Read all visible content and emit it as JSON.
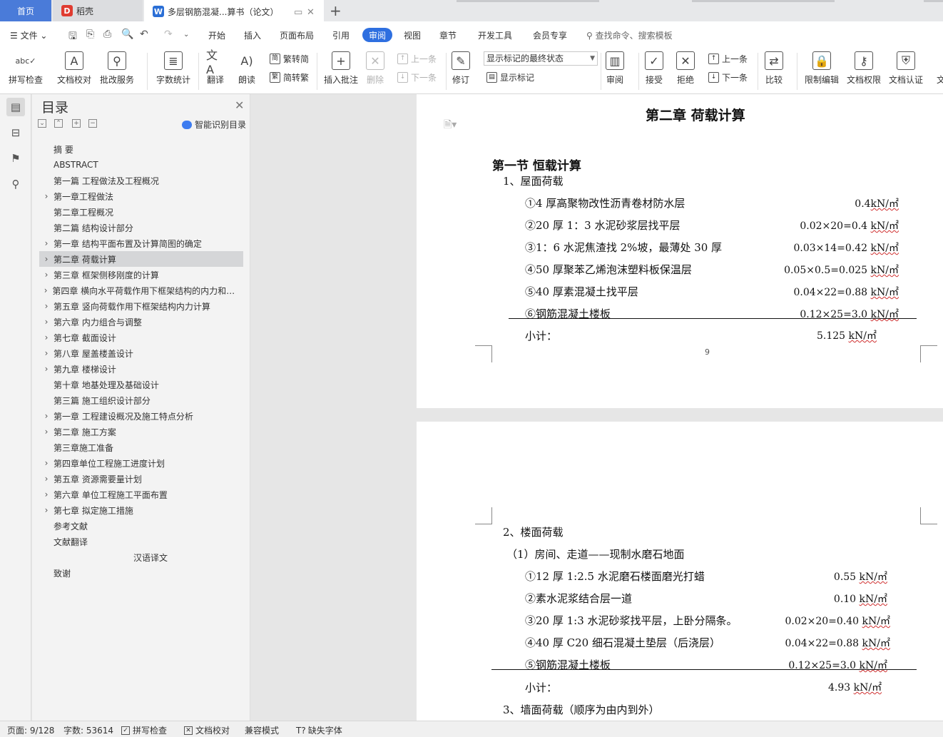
{
  "tabs": {
    "home": "首页",
    "daoke": "稻壳",
    "doc": "多层钢筋混凝...算书（论文）"
  },
  "menu": {
    "file": "文件",
    "items": [
      "开始",
      "插入",
      "页面布局",
      "引用",
      "审阅",
      "视图",
      "章节",
      "开发工具",
      "会员专享"
    ],
    "active": "审阅",
    "search": "查找命令、搜索模板"
  },
  "ribbon": {
    "spell": "拼写检查",
    "doc_check": "文档校对",
    "batch": "批改服务",
    "word_count": "字数统计",
    "translate": "翻译",
    "read": "朗读",
    "to_trad": "繁转简",
    "to_simp": "简转繁",
    "insert_comment": "插入批注",
    "delete": "删除",
    "prev_comment": "上一条",
    "next_comment": "下一条",
    "revise": "修订",
    "state_select": "显示标记的最终状态",
    "show_marks": "显示标记",
    "review": "审阅",
    "accept": "接受",
    "reject": "拒绝",
    "prev_change": "上一条",
    "next_change": "下一条",
    "compare": "比较",
    "restrict": "限制编辑",
    "permission": "文档权限",
    "certify": "文档认证",
    "more": "文"
  },
  "toc": {
    "title": "目录",
    "smart": "智能识别目录",
    "items": [
      {
        "label": "摘  要",
        "chev": false
      },
      {
        "label": "ABSTRACT",
        "chev": false
      },
      {
        "label": "第一篇    工程做法及工程概况",
        "chev": false
      },
      {
        "label": "第一章工程做法",
        "chev": true
      },
      {
        "label": "第二章工程概况",
        "chev": false
      },
      {
        "label": "第二篇    结构设计部分",
        "chev": false
      },
      {
        "label": "第一章    结构平面布置及计算简图的确定",
        "chev": true
      },
      {
        "label": "第二章    荷载计算",
        "chev": true
      },
      {
        "label": "第三章    框架侧移刚度的计算",
        "chev": true
      },
      {
        "label": "第四章    横向水平荷载作用下框架结构的内力和侧移计算",
        "chev": true
      },
      {
        "label": "第五章    竖向荷载作用下框架结构内力计算",
        "chev": true
      },
      {
        "label": "第六章    内力组合与调整",
        "chev": true
      },
      {
        "label": "第七章    截面设计",
        "chev": true
      },
      {
        "label": "第八章    屋盖楼盖设计",
        "chev": true
      },
      {
        "label": "第九章  楼梯设计",
        "chev": true
      },
      {
        "label": "第十章  地基处理及基础设计",
        "chev": false
      },
      {
        "label": "第三篇    施工组织设计部分",
        "chev": false
      },
      {
        "label": "第一章    工程建设概况及施工特点分析",
        "chev": true
      },
      {
        "label": "第二章    施工方案",
        "chev": true
      },
      {
        "label": "第三章施工准备",
        "chev": false
      },
      {
        "label": "第四章单位工程施工进度计划",
        "chev": true
      },
      {
        "label": "第五章    资源需要量计划",
        "chev": true
      },
      {
        "label": "第六章    单位工程施工平面布置",
        "chev": true
      },
      {
        "label": "第七章    拟定施工措施",
        "chev": true
      },
      {
        "label": "参考文献",
        "chev": false
      },
      {
        "label": "文献翻译",
        "chev": false
      },
      {
        "label": "汉语译文",
        "chev": false
      },
      {
        "label": "致谢",
        "chev": false
      }
    ],
    "selected_index": 7
  },
  "page1": {
    "chapter": "第二章   荷载计算",
    "section": "第一节   恒载计算",
    "sub1": "1、屋面荷载",
    "rows": [
      {
        "desc": "①4 厚高聚物改性沥青卷材防水层",
        "calc": "0.4",
        "unit": "kN/㎡"
      },
      {
        "desc": "②20 厚 1：3 水泥砂浆层找平层",
        "calc": "0.02×20=0.4 ",
        "unit": "kN/㎡"
      },
      {
        "desc": "③1：6 水泥焦渣找 2%坡，最薄处 30 厚",
        "calc": "0.03×14=0.42 ",
        "unit": "kN/㎡"
      },
      {
        "desc": "④50 厚聚苯乙烯泡沫塑料板保温层",
        "calc": "0.05×0.5=0.025 ",
        "unit": "kN/㎡"
      },
      {
        "desc": "⑤40 厚素混凝土找平层",
        "calc": "0.04×22=0.88 ",
        "unit": "kN/㎡"
      },
      {
        "desc": "⑥钢筋混凝土楼板",
        "calc": "0.12×25=3.0 ",
        "unit": "kN/㎡"
      }
    ],
    "subtotal_label": "小计：",
    "subtotal_value": "5.125 ",
    "subtotal_unit": "kN/㎡",
    "page_number": "9"
  },
  "page2": {
    "sub2": "2、楼面荷载",
    "sub2_1": "（1）房间、走道——现制水磨石地面",
    "rows": [
      {
        "desc": "①12 厚 1:2.5 水泥磨石楼面磨光打蜡",
        "calc": "0.55 ",
        "unit": "kN/㎡"
      },
      {
        "desc": "②素水泥浆结合层一道",
        "calc": "0.10 ",
        "unit": "kN/㎡"
      },
      {
        "desc": "③20 厚 1:3 水泥砂浆找平层，上卧分隔条。",
        "calc": "0.02×20=0.40 ",
        "unit": "kN/㎡"
      },
      {
        "desc": "④40 厚 C20 细石混凝土垫层（后浇层）",
        "calc": "0.04×22=0.88 ",
        "unit": "kN/㎡"
      },
      {
        "desc": "⑤钢筋混凝土楼板",
        "calc": "0.12×25=3.0 ",
        "unit": "kN/㎡"
      }
    ],
    "subtotal_label": "小计：",
    "subtotal_value": "4.93 ",
    "subtotal_unit": "kN/㎡",
    "sub3": "3、墙面荷载（顺序为由内到外）"
  },
  "status": {
    "page": "页面: 9/128",
    "words": "字数: 53614",
    "spell": "拼写检查",
    "doc_check": "文档校对",
    "compat": "兼容模式",
    "missing_font": "缺失字体"
  }
}
